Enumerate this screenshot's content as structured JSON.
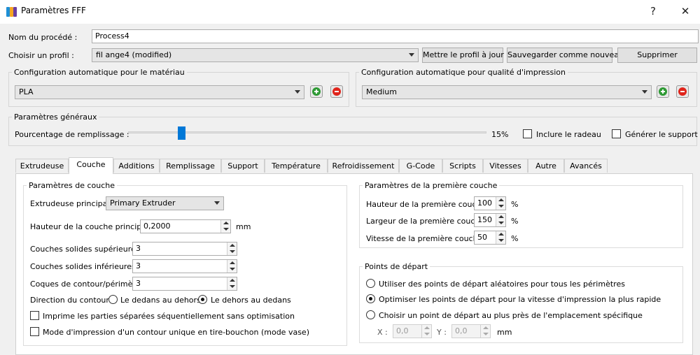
{
  "window": {
    "title": "Paramètres FFF",
    "help_label": "?",
    "close_label": "✕"
  },
  "process": {
    "name_label": "Nom du procédé :",
    "name_value": "Process4"
  },
  "profile": {
    "label": "Choisir un profil :",
    "selected": "fil ange4 (modified)",
    "update_button": "Mettre le profil à jour",
    "save_new_button": "Sauvegarder comme nouveau",
    "delete_button": "Supprimer"
  },
  "material_auto": {
    "title": "Configuration automatique pour le matériau",
    "selected": "PLA"
  },
  "quality_auto": {
    "title": "Configuration automatique pour qualité d'impression",
    "selected": "Medium"
  },
  "general": {
    "title": "Paramètres généraux",
    "infill_label": "Pourcentage de remplissage :",
    "infill_percent": 15,
    "infill_value_text": "15%",
    "raft_label": "Inclure le radeau",
    "support_label": "Générer le support"
  },
  "tabs": [
    {
      "label": "Extrudeuse"
    },
    {
      "label": "Couche"
    },
    {
      "label": "Additions"
    },
    {
      "label": "Remplissage"
    },
    {
      "label": "Support"
    },
    {
      "label": "Température"
    },
    {
      "label": "Refroidissement"
    },
    {
      "label": "G-Code"
    },
    {
      "label": "Scripts"
    },
    {
      "label": "Vitesses"
    },
    {
      "label": "Autre"
    },
    {
      "label": "Avancés"
    }
  ],
  "active_tab": "Couche",
  "layer": {
    "title": "Paramètres de couche",
    "primary_extruder_label": "Extrudeuse principale",
    "primary_extruder_value": "Primary Extruder",
    "primary_height_label": "Hauteur de la couche principale",
    "primary_height_value": "0,2000",
    "primary_height_unit": "mm",
    "top_solid_label": "Couches solides supérieures",
    "top_solid_value": "3",
    "bottom_solid_label": "Couches solides inférieures",
    "bottom_solid_value": "3",
    "perimeter_label": "Coques de contour/périmètre",
    "perimeter_value": "3",
    "direction_label": "Direction du contour :",
    "inside_out_label": "Le dedans au dehors",
    "outside_in_label": "Le dehors au dedans",
    "sequential_label": "Imprime les parties séparées séquentiellement sans optimisation",
    "vase_label": "Mode d'impression d'un contour unique en tire-bouchon (mode vase)"
  },
  "first_layer": {
    "title": "Paramètres de la première couche",
    "height_label": "Hauteur de la première couche",
    "height_value": "100",
    "height_unit": "%",
    "width_label": "Largeur de la première couche",
    "width_value": "150",
    "width_unit": "%",
    "speed_label": "Vitesse de la première couche",
    "speed_value": "50",
    "speed_unit": "%"
  },
  "start_points": {
    "title": "Points de départ",
    "random_label": "Utiliser des points de départ aléatoires pour tous les périmètres",
    "optimize_label": "Optimiser les points de départ pour la vitesse d'impression la plus rapide",
    "specific_label": "Choisir un point de départ au plus près de l'emplacement spécifique",
    "x_label": "X :",
    "x_value": "0,0",
    "y_label": "Y :",
    "y_value": "0,0",
    "unit": "mm"
  },
  "colors": {
    "accent": "#0078d7",
    "add_green": "#2f9a35",
    "remove_red": "#e0241b"
  }
}
